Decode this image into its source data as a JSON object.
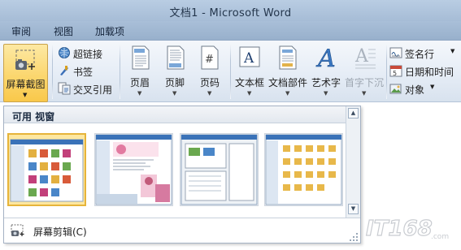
{
  "window": {
    "title": "文档1 - Microsoft Word"
  },
  "tabs": [
    "审阅",
    "视图",
    "加载项"
  ],
  "ribbon": {
    "screenshot": {
      "label": "屏幕截图"
    },
    "links": [
      "超链接",
      "书签",
      "交叉引用"
    ],
    "header_footer": [
      "页眉",
      "页脚",
      "页码"
    ],
    "text": {
      "textbox": "文本框",
      "quickparts": "文档部件",
      "wordart": "艺术字",
      "dropcap": "首字下沉",
      "signature": "签名行",
      "datetime": "日期和时间",
      "object": "对象"
    }
  },
  "gallery": {
    "header": "可用 视窗",
    "thumbnails": [
      {
        "name": "window-thumbnail-1",
        "selected": true
      },
      {
        "name": "window-thumbnail-2",
        "selected": false
      },
      {
        "name": "window-thumbnail-3",
        "selected": false
      },
      {
        "name": "window-thumbnail-4",
        "selected": false
      }
    ],
    "footer_action": "屏幕剪辑(C)"
  },
  "watermark": {
    "text": "IT168.com"
  },
  "colors": {
    "accent_selected": "#fbd56a",
    "ribbon_bg": "#e6edf6",
    "title_bg": "#b9cde3"
  }
}
